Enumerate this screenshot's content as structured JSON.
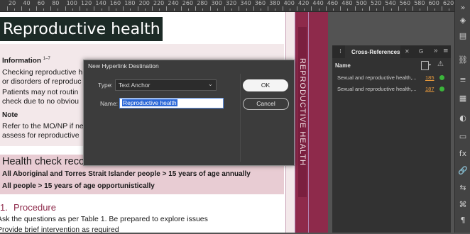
{
  "ruler": {
    "labels": [
      "20",
      "40",
      "60",
      "80",
      "100",
      "120",
      "140",
      "160",
      "180",
      "200",
      "220",
      "240",
      "260",
      "280",
      "300",
      "320",
      "340",
      "360",
      "380",
      "400",
      "420",
      "440",
      "460",
      "480",
      "500",
      "520",
      "540",
      "560",
      "580",
      "600",
      "620"
    ]
  },
  "document": {
    "title": "Reproductive health",
    "info_heading": "Information",
    "info_sup": "1–7",
    "info_line1": "Checking reproductive h",
    "info_line2": "or disorders of reproduc",
    "info_line3": "Patients may not routin",
    "info_line4": "check due to no obviou",
    "note_heading": "Note",
    "note_line1": "Refer to the MO/NP if ne",
    "note_line2": "assess for reproductive",
    "hc_heading": "Health check recommendations",
    "hc_line1": "All Aboriginal and Torres Strait Islander people > 15 years of age annually",
    "hc_line2": "All people > 15 years of age opportunistically",
    "proc_number": "1.",
    "proc_heading": "Procedure",
    "proc_line1": "Ask the questions as per Table 1. Be prepared to explore issues",
    "proc_line2": "Provide brief intervention as required"
  },
  "sidebar": {
    "vertical_title": "REPRODUCTIVE HEALTH"
  },
  "xref_panel": {
    "tab_label": "Cross-References",
    "other_tabs": [
      "G",
      "»"
    ],
    "column_name": "Name",
    "rows": [
      {
        "name": "Sexual and reproductive health,...",
        "page": "185",
        "status": "ok"
      },
      {
        "name": "Sexual and reproductive health,...",
        "page": "187",
        "status": "ok"
      }
    ]
  },
  "dialog": {
    "title": "New Hyperlink Destination",
    "type_label": "Type:",
    "type_value": "Text Anchor",
    "name_label": "Name:",
    "name_value": "Reproductive health",
    "ok_label": "OK",
    "cancel_label": "Cancel"
  },
  "colors": {
    "sidebar_maroon": "#8e2a4b",
    "info_bg": "#f3e8ea",
    "hc_bg": "#e8ccd3",
    "procedure_heading": "#8e2a4b",
    "status_ok": "#3bb53b",
    "page_link": "#e99a3b"
  },
  "icons": {
    "chevron": "chevron-down-icon",
    "new_ref": "new-page-icon",
    "warning": "warning-icon",
    "panel_menu": "menu-icon"
  }
}
